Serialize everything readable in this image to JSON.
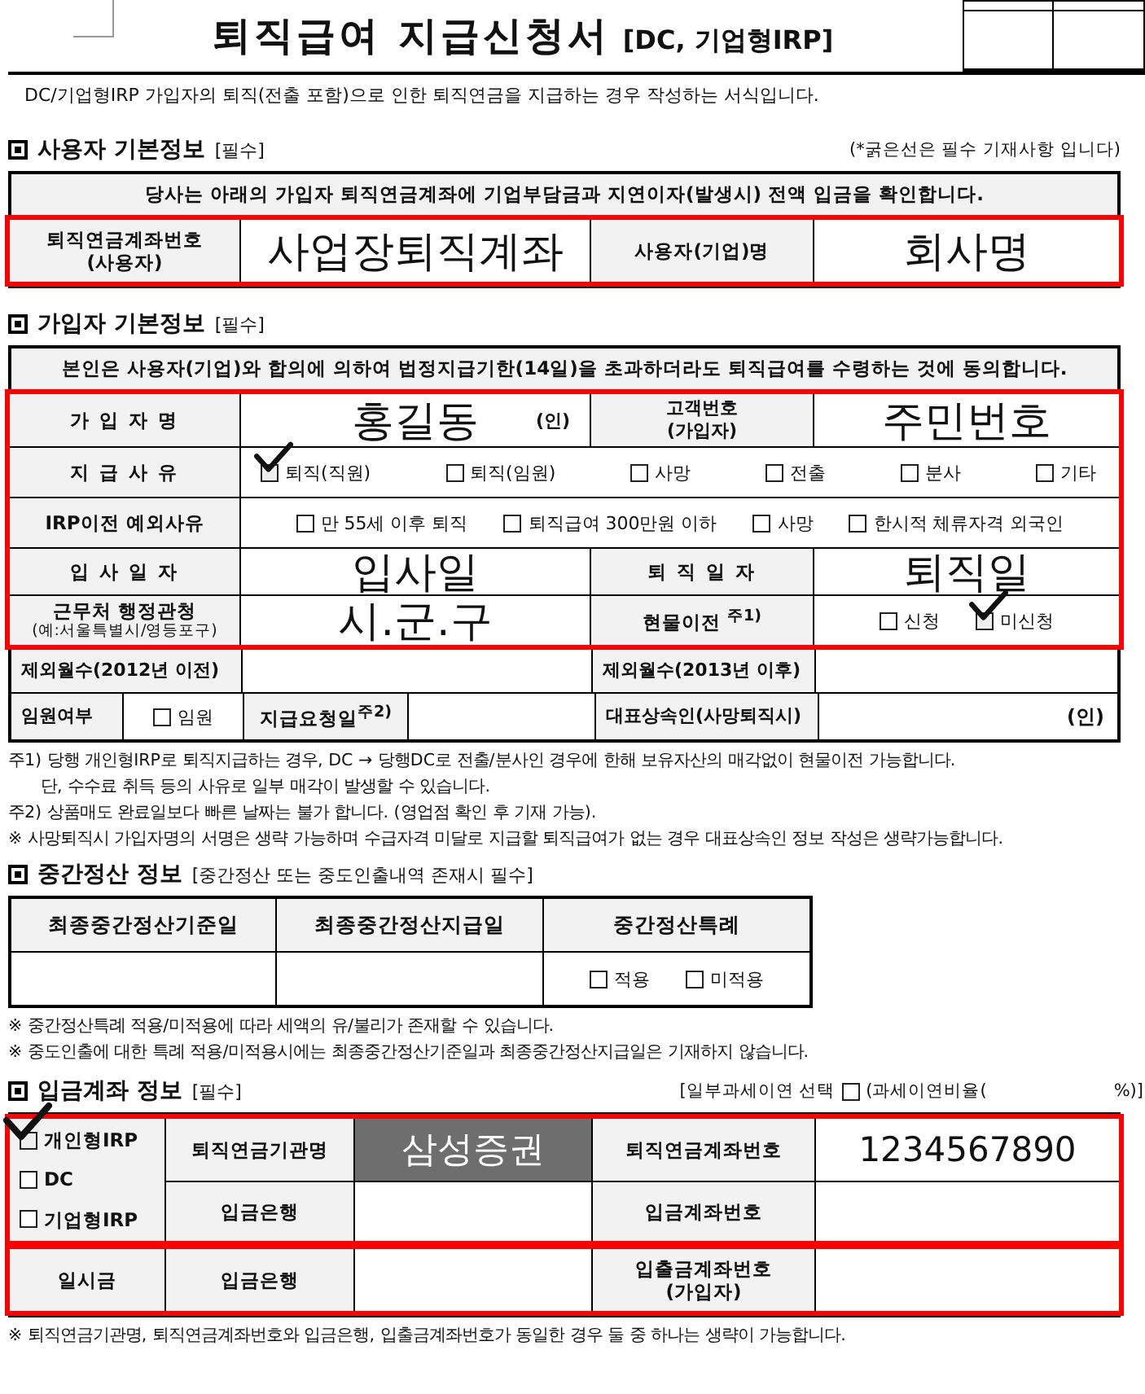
{
  "title": {
    "main": "퇴직급여 지급신청서",
    "suffix": "[DC, 기업형IRP]"
  },
  "intro": "DC/기업형IRP 가입자의 퇴직(전출 포함)으로 인한 퇴직연금을 지급하는 경우 작성하는 서식입니다.",
  "employer": {
    "heading": "사용자 기본정보",
    "tag": "[필수]",
    "note": "(*굵은선은 필수 기재사항 입니다)",
    "banner": "당사는 아래의 가입자 퇴직연금계좌에 기업부담금과 지연이자(발생시) 전액 입금을 확인합니다.",
    "outlined": true,
    "fields": [
      {
        "label": "퇴직연금계좌번호",
        "sublabel": "(사용자)",
        "value": "사업장퇴직계좌"
      },
      {
        "label": "사용자(기업)명",
        "value": "회사명"
      }
    ]
  },
  "member": {
    "heading": "가입자 기본정보",
    "tag": "[필수]",
    "banner": "본인은 사용자(기업)와 합의에 의하여 법정지급기한(14일)을 초과하더라도 퇴직급여를 수령하는 것에 동의합니다.",
    "outlined": true,
    "name": {
      "label": "가 입 자 명",
      "value": "홍길동",
      "seal": "(인)"
    },
    "customer_no": {
      "label": "고객번호",
      "sublabel": "(가입자)",
      "value": "주민번호"
    },
    "reason": {
      "label": "지 급 사 유",
      "options": [
        {
          "label": "퇴직(직원)",
          "checked": true
        },
        {
          "label": "퇴직(임원)",
          "checked": false
        },
        {
          "label": "사망",
          "checked": false
        },
        {
          "label": "전출",
          "checked": false
        },
        {
          "label": "분사",
          "checked": false
        },
        {
          "label": "기타",
          "checked": false
        }
      ]
    },
    "irp_exception": {
      "label": "IRP이전 예외사유",
      "options": [
        {
          "label": "만 55세 이후 퇴직",
          "checked": false
        },
        {
          "label": "퇴직급여 300만원 이하",
          "checked": false
        },
        {
          "label": "사망",
          "checked": false
        },
        {
          "label": "한시적 체류자격 외국인",
          "checked": false
        }
      ]
    },
    "join_date": {
      "label": "입 사 일 자",
      "value": "입사일"
    },
    "retire_date": {
      "label": "퇴 직 일 자",
      "value": "퇴직일"
    },
    "office": {
      "label": "근무처 행정관청",
      "sublabel": "(예:서울특별시/영등포구)",
      "value": "시.군.구"
    },
    "in_kind": {
      "label": "현물이전 $^{주1)}$",
      "options": [
        {
          "label": "신청",
          "checked": false
        },
        {
          "label": "미신청",
          "checked": true
        }
      ]
    },
    "excluded_before": {
      "label": "제외월수(2012년 이전)"
    },
    "excluded_after": {
      "label": "제외월수(2013년 이후)"
    },
    "executive": {
      "label": "임원여부",
      "options": [
        {
          "label": "임원",
          "checked": false
        }
      ]
    },
    "request_date": {
      "label": "지급요청일$^{주2)}$"
    },
    "heir": {
      "label": "대표상속인(사망퇴직시)",
      "seal": "(인)"
    }
  },
  "member_notes": [
    {
      "kind": "footnote",
      "text": "주1) 당행 개인형IRP로 퇴직지급하는 경우, DC → 당행DC로 전출/분사인 경우에 한해 보유자산의 매각없이 현물이전 가능합니다."
    },
    {
      "kind": "continued",
      "text": "단, 수수료 취득 등의 사유로 일부 매각이 발생할 수 있습니다."
    },
    {
      "kind": "footnote",
      "text": "주2) 상품매도 완료일보다 빠른 날짜는 불가 합니다. (영업점 확인 후 기재 가능)."
    },
    {
      "kind": "footnote",
      "text": "※ 사망퇴직시 가입자명의 서명은 생략 가능하며 수급자격 미달로 지급할 퇴직급여가 없는 경우 대표상속인 정보 작성은 생략가능합니다."
    }
  ],
  "interim": {
    "heading": "중간정산 정보",
    "tag": "[중간정산 또는 중도인출내역 존재시 필수]",
    "columns": [
      "최종중간정산기준일",
      "최종중간정산지급일",
      "중간정산특례"
    ],
    "options": [
      {
        "label": "적용",
        "checked": false
      },
      {
        "label": "미적용",
        "checked": false
      }
    ]
  },
  "interim_notes": [
    "※ 중간정산특례 적용/미적용에 따라 세액의 유/불리가 존재할 수 있습니다.",
    "※ 중도인출에 대한 특례 적용/미적용시에는 최종중간정산기준일과 최종중간정산지급일은 기재하지 않습니다."
  ],
  "deposit": {
    "heading": "입금계좌 정보",
    "tag": "[필수]",
    "tax_deferral": {
      "label": "[일부과세이연 선택",
      "checked": false,
      "ratio_label": "(과세이연비율(",
      "ratio_unit": "%)]"
    },
    "outlined": true,
    "account_types": [
      {
        "label": "개인형IRP",
        "checked": true
      },
      {
        "label": "DC",
        "checked": false
      },
      {
        "label": "기업형IRP",
        "checked": false
      }
    ],
    "institution": {
      "label": "퇴직연금기관명",
      "value": "삼성증권"
    },
    "pension_account": {
      "label": "퇴직연금계좌번호",
      "value": "1234567890"
    },
    "bank": {
      "label": "입금은행"
    },
    "deposit_account": {
      "label": "입금계좌번호"
    },
    "lump_sum": {
      "label": "일시금",
      "outlined": true,
      "bank_label": "입금은행",
      "account_label": "입출금계좌번호",
      "account_sublabel": "(가입자)"
    }
  },
  "deposit_notes": [
    "※ 퇴직연금기관명, 퇴직연금계좌번호와 입금은행, 입출금계좌번호가 동일한 경우 둘 중 하나는 생략이 가능합니다."
  ]
}
